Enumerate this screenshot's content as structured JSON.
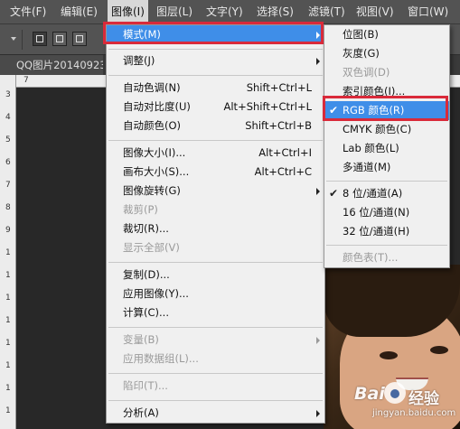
{
  "menubar": {
    "items": [
      "文件(F)",
      "编辑(E)",
      "图像(I)",
      "图层(L)",
      "文字(Y)",
      "选择(S)",
      "滤镜(T)",
      "视图(V)",
      "窗口(W)"
    ],
    "active": "图像(I)"
  },
  "document": {
    "tab_title": "QQ图片20140923"
  },
  "rulers": {
    "horizontal": [
      "7"
    ],
    "vertical": [
      "3",
      "4",
      "5",
      "6",
      "7",
      "8",
      "9",
      "1",
      "1",
      "1",
      "1",
      "1",
      "1",
      "1",
      "1"
    ]
  },
  "image_menu": {
    "items": [
      {
        "label": "模式(M)",
        "shortcut": "",
        "submenu": true,
        "disabled": false,
        "highlighted": true
      },
      {
        "label": "调整(J)",
        "shortcut": "",
        "submenu": true,
        "disabled": false
      },
      {
        "label": "自动色调(N)",
        "shortcut": "Shift+Ctrl+L",
        "disabled": false
      },
      {
        "label": "自动对比度(U)",
        "shortcut": "Alt+Shift+Ctrl+L",
        "disabled": false
      },
      {
        "label": "自动颜色(O)",
        "shortcut": "Shift+Ctrl+B",
        "disabled": false
      },
      {
        "label": "图像大小(I)...",
        "shortcut": "Alt+Ctrl+I",
        "disabled": false
      },
      {
        "label": "画布大小(S)...",
        "shortcut": "Alt+Ctrl+C",
        "disabled": false
      },
      {
        "label": "图像旋转(G)",
        "shortcut": "",
        "submenu": true,
        "disabled": false
      },
      {
        "label": "裁剪(P)",
        "shortcut": "",
        "disabled": true
      },
      {
        "label": "裁切(R)...",
        "shortcut": "",
        "disabled": false
      },
      {
        "label": "显示全部(V)",
        "shortcut": "",
        "disabled": true
      },
      {
        "label": "复制(D)...",
        "shortcut": "",
        "disabled": false
      },
      {
        "label": "应用图像(Y)...",
        "shortcut": "",
        "disabled": false
      },
      {
        "label": "计算(C)...",
        "shortcut": "",
        "disabled": false
      },
      {
        "label": "变量(B)",
        "shortcut": "",
        "submenu": true,
        "disabled": true
      },
      {
        "label": "应用数据组(L)...",
        "shortcut": "",
        "disabled": true
      },
      {
        "label": "陷印(T)...",
        "shortcut": "",
        "disabled": true
      },
      {
        "label": "分析(A)",
        "shortcut": "",
        "submenu": true,
        "disabled": false
      }
    ]
  },
  "mode_submenu": {
    "items": [
      {
        "label": "位图(B)",
        "disabled": false,
        "checked": false
      },
      {
        "label": "灰度(G)",
        "disabled": false,
        "checked": false
      },
      {
        "label": "双色调(D)",
        "disabled": true,
        "checked": false
      },
      {
        "label": "索引颜色(I)...",
        "disabled": false,
        "checked": false
      },
      {
        "label": "RGB 颜色(R)",
        "disabled": false,
        "checked": true,
        "highlighted": true
      },
      {
        "label": "CMYK 颜色(C)",
        "disabled": false,
        "checked": false
      },
      {
        "label": "Lab 颜色(L)",
        "disabled": false,
        "checked": false
      },
      {
        "label": "多通道(M)",
        "disabled": false,
        "checked": false
      },
      {
        "label": "8 位/通道(A)",
        "disabled": false,
        "checked": true
      },
      {
        "label": "16 位/通道(N)",
        "disabled": false,
        "checked": false
      },
      {
        "label": "32 位/通道(H)",
        "disabled": false,
        "checked": false
      },
      {
        "label": "颜色表(T)...",
        "disabled": true,
        "checked": false
      }
    ]
  },
  "watermark": {
    "logo_a": "Bai",
    "logo_b": "经验",
    "url": "jingyan.baidu.com"
  },
  "colors": {
    "highlight": "#3f8ee8",
    "annotation_box": "#d92a3a",
    "menu_bg": "#f0f0f0",
    "chrome_bg": "#535353"
  },
  "icons": {
    "check": "✔",
    "submenu": "arrow-right-icon"
  }
}
